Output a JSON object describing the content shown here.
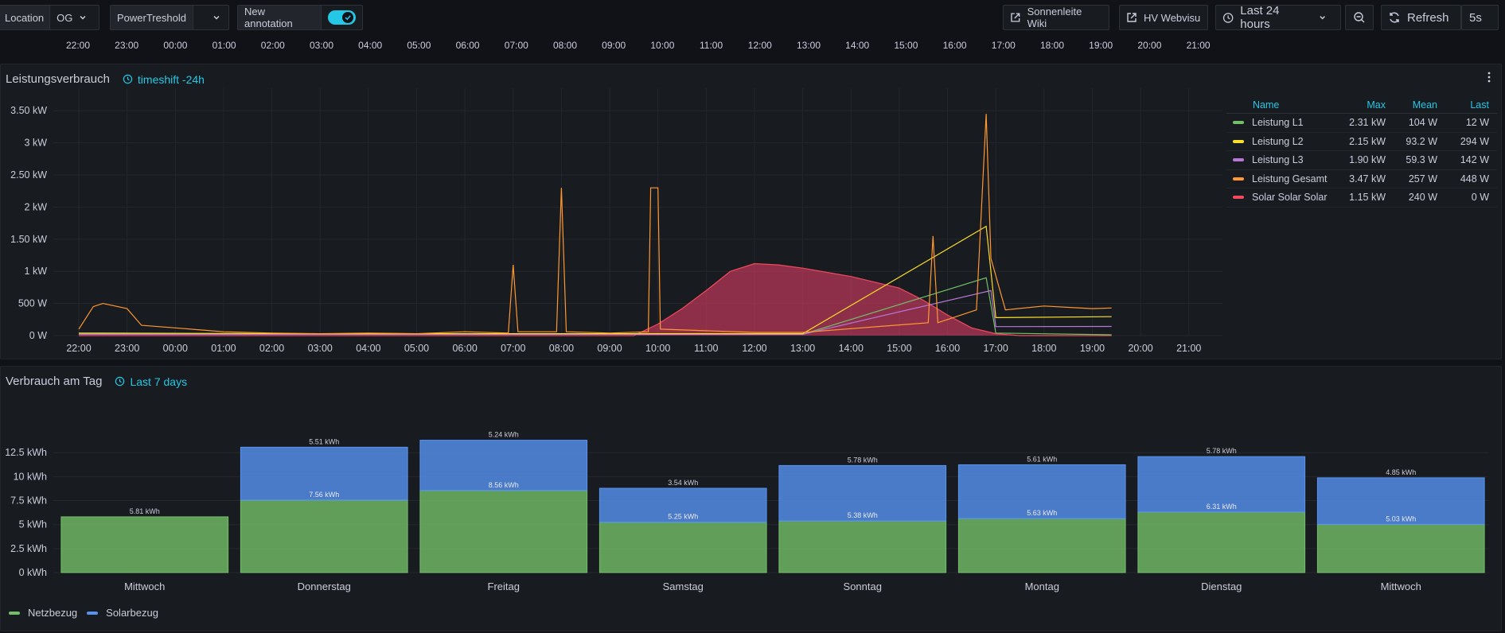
{
  "toolbar": {
    "location_label": "Location",
    "location_value": "OG",
    "threshold_label": "PowerTreshold",
    "threshold_value": "",
    "annotation_label": "New annotation",
    "link1": "Sonnenleite Wiki",
    "link2": "HV Webvisu",
    "time_range": "Last 24 hours",
    "refresh_label": "Refresh",
    "refresh_interval": "5s"
  },
  "top_time_ticks": [
    "22:00",
    "23:00",
    "00:00",
    "01:00",
    "02:00",
    "03:00",
    "04:00",
    "05:00",
    "06:00",
    "07:00",
    "08:00",
    "09:00",
    "10:00",
    "11:00",
    "12:00",
    "13:00",
    "14:00",
    "15:00",
    "16:00",
    "17:00",
    "18:00",
    "19:00",
    "20:00",
    "21:00"
  ],
  "panel1": {
    "title": "Leistungsverbrauch",
    "timeshift": "timeshift -24h",
    "legend_headers": {
      "name": "Name",
      "max": "Max",
      "mean": "Mean",
      "last": "Last"
    },
    "legend_rows": [
      {
        "name": "Leistung L1",
        "max": "2.31 kW",
        "mean": "104 W",
        "last": "12 W",
        "color": "#73bf69"
      },
      {
        "name": "Leistung L2",
        "max": "2.15 kW",
        "mean": "93.2 W",
        "last": "294 W",
        "color": "#fade2a"
      },
      {
        "name": "Leistung L3",
        "max": "1.90 kW",
        "mean": "59.3 W",
        "last": "142 W",
        "color": "#b877d9"
      },
      {
        "name": "Leistung Gesamt",
        "max": "3.47 kW",
        "mean": "257 W",
        "last": "448 W",
        "color": "#ff9830"
      },
      {
        "name": "Solar Solar Solar",
        "max": "1.15 kW",
        "mean": "240 W",
        "last": "0 W",
        "color": "#f2495c"
      }
    ]
  },
  "chart_data": [
    {
      "type": "line",
      "title": "Leistungsverbrauch",
      "x_ticks": [
        "22:00",
        "23:00",
        "00:00",
        "01:00",
        "02:00",
        "03:00",
        "04:00",
        "05:00",
        "06:00",
        "07:00",
        "08:00",
        "09:00",
        "10:00",
        "11:00",
        "12:00",
        "13:00",
        "14:00",
        "15:00",
        "16:00",
        "17:00",
        "18:00",
        "19:00",
        "20:00",
        "21:00"
      ],
      "y_ticks": [
        "0 W",
        "500 W",
        "1 kW",
        "1.50 kW",
        "2 kW",
        "2.50 kW",
        "3 kW",
        "3.50 kW"
      ],
      "ylim_w": [
        0,
        3750
      ],
      "grid": true,
      "legend_position": "right",
      "series": [
        {
          "name": "Leistung Gesamt",
          "color": "#ff9830",
          "points_h_w": [
            [
              0,
              100
            ],
            [
              0.3,
              450
            ],
            [
              0.5,
              500
            ],
            [
              1,
              420
            ],
            [
              1.3,
              160
            ],
            [
              2,
              120
            ],
            [
              3,
              60
            ],
            [
              4,
              40
            ],
            [
              5,
              30
            ],
            [
              6,
              40
            ],
            [
              7,
              30
            ],
            [
              8,
              60
            ],
            [
              8.9,
              40
            ],
            [
              9.0,
              1100
            ],
            [
              9.1,
              60
            ],
            [
              9.9,
              60
            ],
            [
              10.0,
              2300
            ],
            [
              10.1,
              60
            ],
            [
              11,
              40
            ],
            [
              11.8,
              60
            ],
            [
              11.85,
              2300
            ],
            [
              12.0,
              2300
            ],
            [
              12.05,
              100
            ],
            [
              14,
              50
            ],
            [
              15,
              50
            ],
            [
              17.6,
              200
            ],
            [
              17.7,
              1550
            ],
            [
              17.8,
              200
            ],
            [
              18.6,
              400
            ],
            [
              18.8,
              3450
            ],
            [
              18.9,
              1200
            ],
            [
              19.2,
              400
            ],
            [
              20,
              460
            ],
            [
              21,
              420
            ],
            [
              21.4,
              430
            ]
          ]
        },
        {
          "name": "Solar Solar Solar",
          "color": "#f2495c",
          "points_h_w": [
            [
              0,
              0
            ],
            [
              11.5,
              0
            ],
            [
              12,
              180
            ],
            [
              12.5,
              420
            ],
            [
              13,
              700
            ],
            [
              13.5,
              1000
            ],
            [
              14,
              1120
            ],
            [
              14.5,
              1100
            ],
            [
              15,
              1050
            ],
            [
              16,
              920
            ],
            [
              17,
              740
            ],
            [
              17.5,
              550
            ],
            [
              18,
              320
            ],
            [
              18.5,
              120
            ],
            [
              19,
              30
            ],
            [
              19.5,
              0
            ],
            [
              21.4,
              0
            ]
          ]
        },
        {
          "name": "Leistung L1",
          "color": "#73bf69",
          "points_h_w": [
            [
              0,
              30
            ],
            [
              5,
              20
            ],
            [
              10,
              30
            ],
            [
              15,
              20
            ],
            [
              18.8,
              900
            ],
            [
              19,
              40
            ],
            [
              21.4,
              12
            ]
          ]
        },
        {
          "name": "Leistung L2",
          "color": "#fade2a",
          "points_h_w": [
            [
              0,
              40
            ],
            [
              5,
              30
            ],
            [
              10,
              30
            ],
            [
              15,
              30
            ],
            [
              18.8,
              1700
            ],
            [
              19,
              280
            ],
            [
              21.4,
              294
            ]
          ]
        },
        {
          "name": "Leistung L3",
          "color": "#b877d9",
          "points_h_w": [
            [
              0,
              20
            ],
            [
              5,
              20
            ],
            [
              10,
              20
            ],
            [
              15,
              20
            ],
            [
              18.9,
              700
            ],
            [
              19,
              140
            ],
            [
              21.4,
              142
            ]
          ]
        }
      ]
    },
    {
      "type": "bar",
      "title": "Verbrauch am Tag",
      "categories": [
        "Mittwoch",
        "Donnerstag",
        "Freitag",
        "Samstag",
        "Sonntag",
        "Montag",
        "Dienstag",
        "Mittwoch"
      ],
      "y_ticks": [
        "0 kWh",
        "2.5 kWh",
        "5 kWh",
        "7.5 kWh",
        "10 kWh",
        "12.5 kWh"
      ],
      "ylim": [
        0,
        15
      ],
      "series": [
        {
          "name": "Netzbezug",
          "color": "#73bf69",
          "values": [
            5.81,
            7.56,
            8.56,
            5.25,
            5.38,
            5.63,
            6.31,
            5.03
          ],
          "labels": [
            "5.81 kWh",
            "7.56 kWh",
            "8.56 kWh",
            "5.25 kWh",
            "5.38 kWh",
            "5.63 kWh",
            "6.31 kWh",
            "5.03 kWh"
          ]
        },
        {
          "name": "Solarbezug",
          "color": "#5794f2",
          "values": [
            0,
            5.51,
            5.24,
            3.54,
            5.78,
            5.61,
            5.78,
            4.85
          ],
          "labels": [
            "",
            "5.51 kWh",
            "5.24 kWh",
            "3.54 kWh",
            "5.78 kWh",
            "5.61 kWh",
            "5.78 kWh",
            "4.85 kWh"
          ]
        }
      ]
    }
  ],
  "panel2": {
    "title": "Verbrauch am Tag",
    "timeshift": "Last 7 days",
    "legend": [
      "Netzbezug",
      "Solarbezug"
    ]
  },
  "colors": {
    "accent": "#24c8e6",
    "panel_bg": "#181b1f",
    "page_bg": "#111217"
  },
  "icons": [
    "chevron-down-icon",
    "external-link-icon",
    "clock-icon",
    "zoom-out-icon",
    "refresh-icon",
    "more-vertical-icon"
  ]
}
